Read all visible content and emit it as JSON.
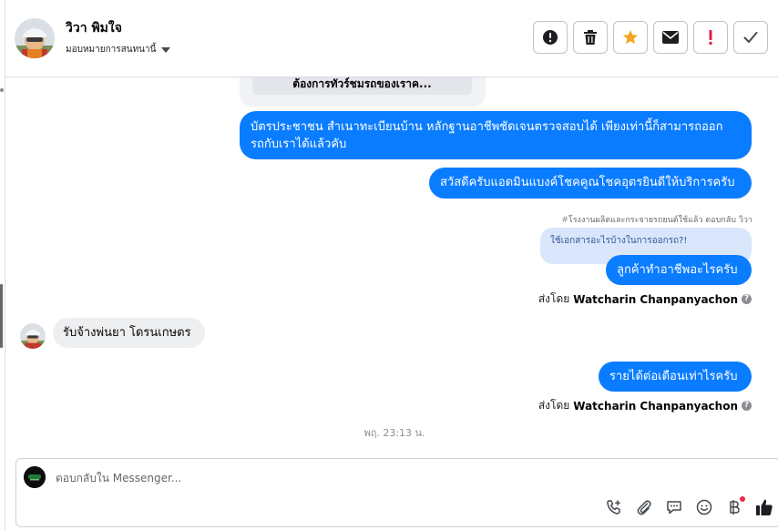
{
  "contact": {
    "name": "วิวา พิมใจ",
    "assign_label": "มอบหมายการสนทนานี้"
  },
  "toolbar": {
    "buttons": [
      {
        "icon": "alert-circle-icon",
        "color": "#1c1e21"
      },
      {
        "icon": "trash-icon",
        "color": "#1c1e21"
      },
      {
        "icon": "star-icon",
        "color": "#f5a623"
      },
      {
        "icon": "envelope-icon",
        "color": "#1c1e21"
      },
      {
        "icon": "exclamation-icon",
        "color": "#e41e3f"
      },
      {
        "icon": "checkmark-icon",
        "color": "#444950"
      }
    ]
  },
  "messages": {
    "quoted_top": "ต้องการทัวร์ชมรถของเราค...",
    "out_1_line1": "บัตรประชาชน สำเนาทะเบียนบ้าน หลักฐานอาชีพชัดเจนตรวจสอบได้ เพียงเท่านี้ก็สามารถออก",
    "out_1_line2": "รถกับเราได้แล้วคับ",
    "out_2": "สวัสดีครับแอดมินแบงค์โชคคูณโชคอุตรยินดีให้บริการครับ",
    "reply_caption_prefix": "#",
    "reply_caption": "โรงงานผลิตและกระจายรถยนต์ใช้แล้ว ตอบกลับ วิวา",
    "quoted_mini": "ใช้เอกสารอะไรบ้างในการออกรถ?!",
    "out_3": "ลูกค้าทำอาชีพอะไรครับ",
    "sent_by_prefix": "ส่งโดย",
    "agent_name": "Watcharin Chanpanyachon",
    "in_1": "รับจ้างพ่นยา โดรนเกษตร",
    "out_4": "รายได้ต่อเดือนเท่าไรครับ",
    "timestamp": "พฤ. 23:13 น."
  },
  "composer": {
    "placeholder": "ตอบกลับใน Messenger...",
    "tools": [
      "phone-plus-icon",
      "paperclip-icon",
      "chat-bubble-icon",
      "smiley-icon",
      "baht-icon",
      "thumbs-up-icon"
    ]
  },
  "colors": {
    "outgoing_bubble": "#0a7cff",
    "incoming_bubble": "#eeeff1",
    "thumbs_up": "#1c1e21"
  }
}
